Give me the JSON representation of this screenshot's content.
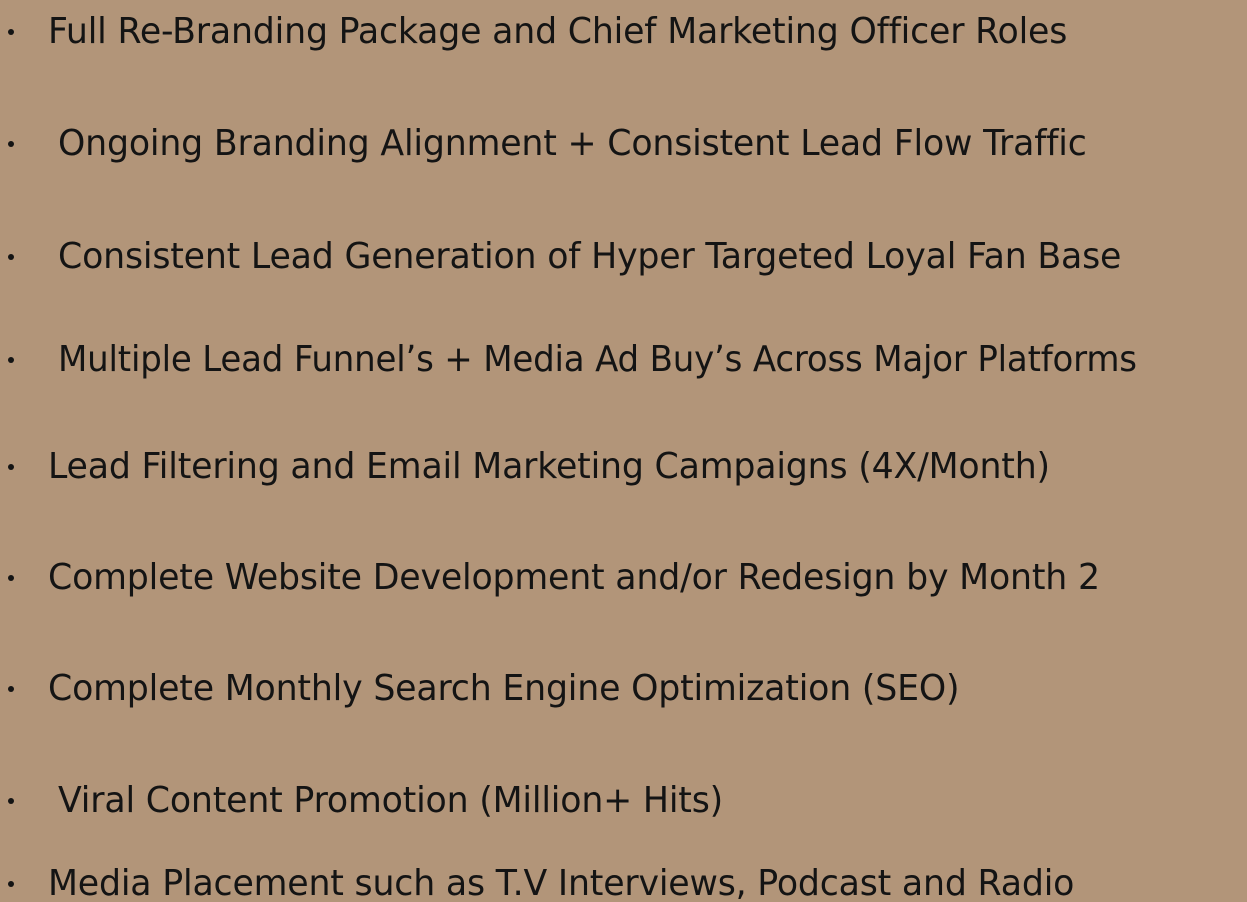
{
  "items": [
    {
      "label": "Full Re-Branding Package and Chief Marketing Officer Roles"
    },
    {
      "label": "Ongoing Branding Alignment + Consistent Lead Flow Traffic"
    },
    {
      "label": "Consistent Lead Generation of Hyper Targeted Loyal Fan Base"
    },
    {
      "label": "Multiple Lead Funnel’s + Media Ad Buy’s Across Major Platforms"
    },
    {
      "label": "Lead Filtering and Email Marketing Campaigns (4X/Month)"
    },
    {
      "label": "Complete Website Development and/or Redesign by Month 2"
    },
    {
      "label": "Complete Monthly Search Engine Optimization (SEO)"
    },
    {
      "label": "Viral Content Promotion (Million+ Hits)"
    },
    {
      "label": "Media Placement such as T.V Interviews, Podcast and Radio"
    }
  ],
  "colors": {
    "background": "#b29579",
    "text": "#141414"
  }
}
